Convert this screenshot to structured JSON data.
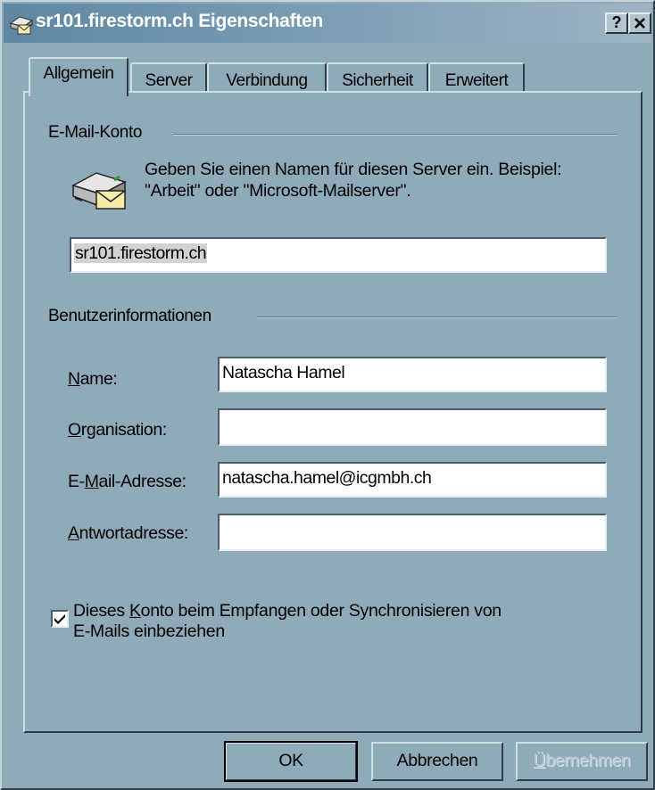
{
  "window": {
    "title": "sr101.firestorm.ch Eigenschaften",
    "help_button": "?",
    "close_button": "×"
  },
  "tabs": [
    {
      "label": "Allgemein",
      "active": true
    },
    {
      "label": "Server",
      "active": false
    },
    {
      "label": "Verbindung",
      "active": false
    },
    {
      "label": "Sicherheit",
      "active": false
    },
    {
      "label": "Erweitert",
      "active": false
    }
  ],
  "email_account": {
    "group_label": "E-Mail-Konto",
    "description_line1": "Geben Sie einen Namen für diesen Server ein. Beispiel:",
    "description_line2": "\"Arbeit\" oder \"Microsoft-Mailserver\".",
    "account_name": "sr101.firestorm.ch",
    "icon": "mail-server-icon"
  },
  "user_info": {
    "group_label": "Benutzerinformationen",
    "fields": [
      {
        "label_accel": "N",
        "label_rest": "ame:",
        "value": "Natascha Hamel"
      },
      {
        "label_accel": "O",
        "label_rest": "rganisation:",
        "value": ""
      },
      {
        "label_pre": "E-",
        "label_accel": "M",
        "label_rest": "ail-Adresse:",
        "value": "natascha.hamel@icgmbh.ch"
      },
      {
        "label_accel": "A",
        "label_rest": "ntwortadresse:",
        "value": ""
      }
    ]
  },
  "include_account": {
    "checked": true,
    "label_pre": "Dieses ",
    "label_accel": "K",
    "label_mid": "onto beim Empfangen oder Synchronisieren von",
    "label_line2": "E-Mails einbeziehen"
  },
  "buttons": {
    "ok": "OK",
    "cancel": "Abbrechen",
    "apply_accel": "Ü",
    "apply_rest": "bernehmen"
  },
  "colors": {
    "face": "#8faab9",
    "title_gradient_start": "#5f87a3",
    "title_gradient_end": "#9fb5c4"
  }
}
